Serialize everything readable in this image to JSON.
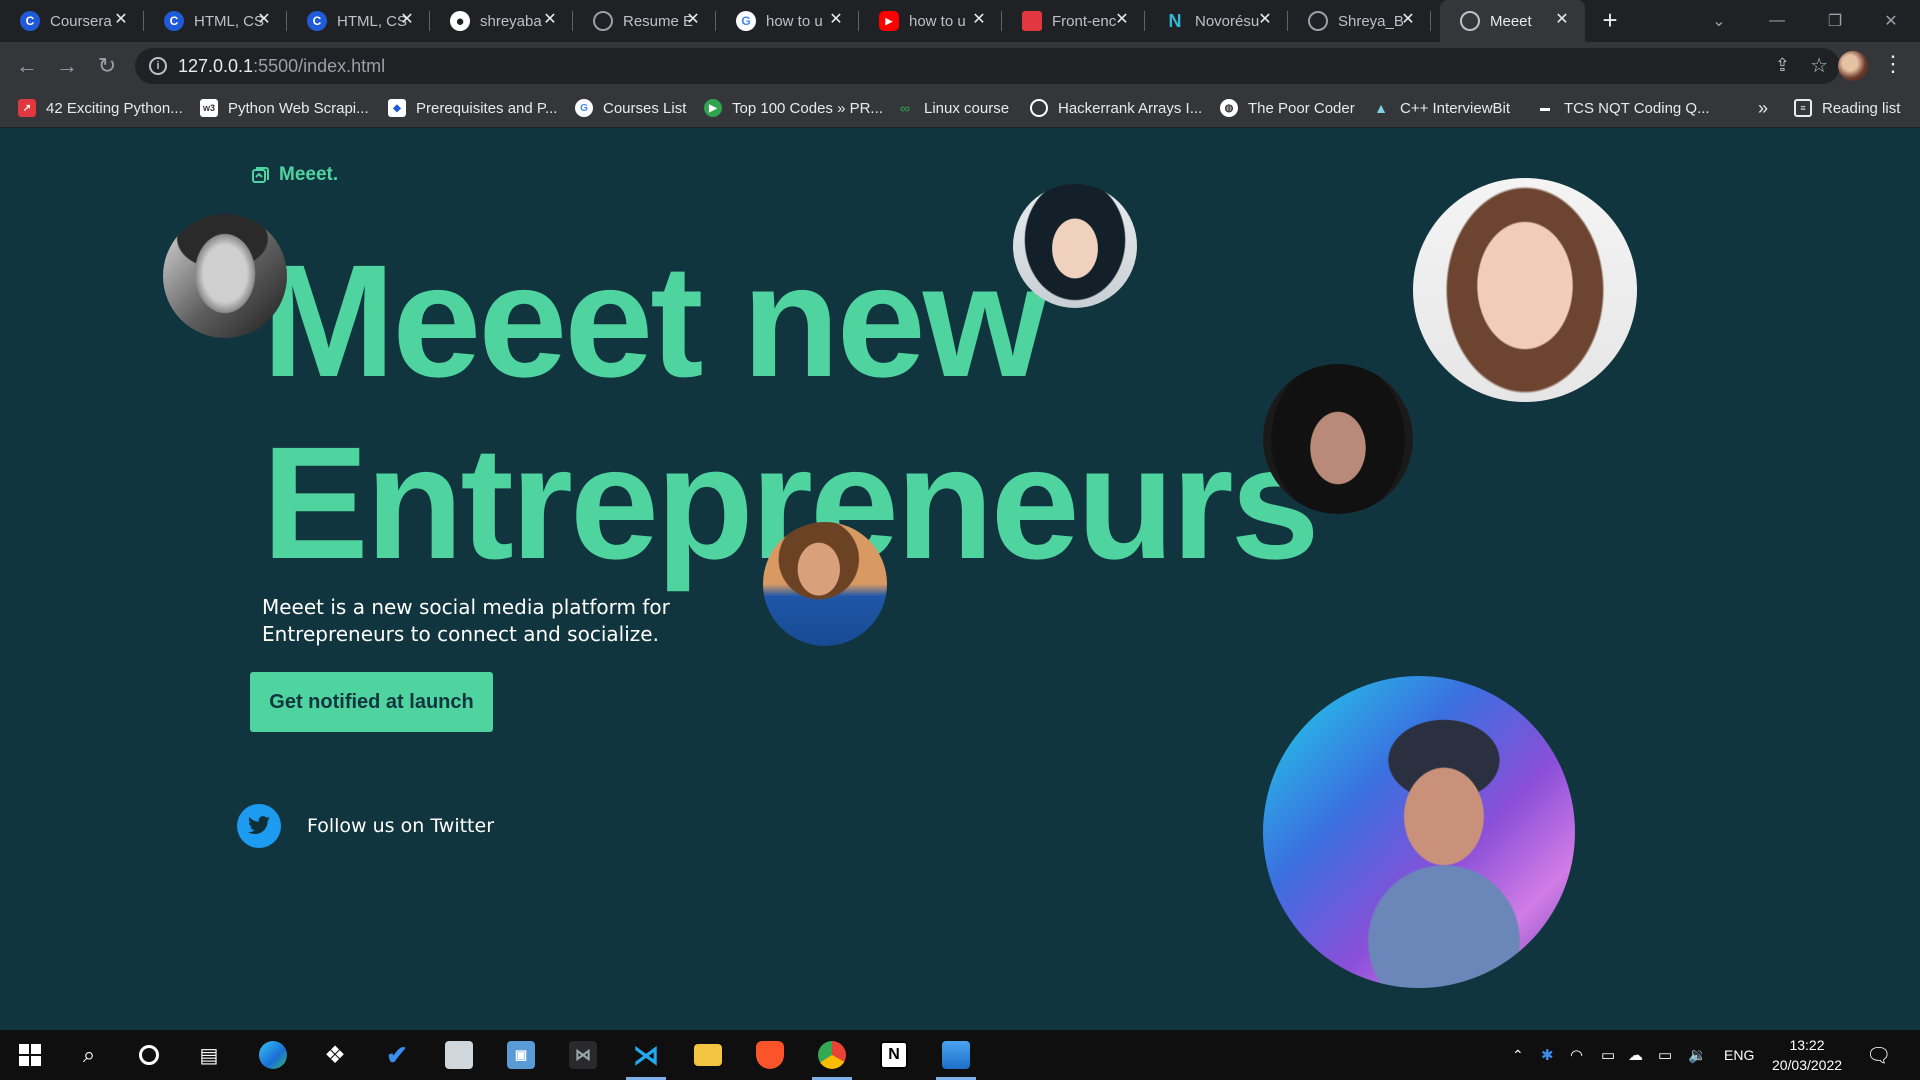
{
  "browser": {
    "tabs": [
      {
        "title": "Coursera",
        "icon": "coursera-icon",
        "color": "#1f5bd8",
        "glyph": "C",
        "active": false
      },
      {
        "title": "HTML, CS",
        "icon": "coursera-icon",
        "color": "#1f5bd8",
        "glyph": "C",
        "active": false
      },
      {
        "title": "HTML, CS",
        "icon": "coursera-icon",
        "color": "#1f5bd8",
        "glyph": "C",
        "active": false
      },
      {
        "title": "shreyaba",
        "icon": "github-icon",
        "color": "#ffffff",
        "glyph": "●",
        "active": false
      },
      {
        "title": "Resume E",
        "icon": "globe-icon",
        "color": "#9aa0a6",
        "glyph": "◍",
        "active": false
      },
      {
        "title": "how to u",
        "icon": "google-icon",
        "color": "#ffffff",
        "glyph": "G",
        "active": false
      },
      {
        "title": "how to u",
        "icon": "youtube-icon",
        "color": "#ff0000",
        "glyph": "▶",
        "active": false
      },
      {
        "title": "Front-enc",
        "icon": "frontend-mentor-icon",
        "color": "#e0383e",
        "glyph": "■",
        "active": false
      },
      {
        "title": "Novorésu",
        "icon": "novoresume-icon",
        "color": "#2fb9d8",
        "glyph": "N",
        "active": false
      },
      {
        "title": "Shreya_B",
        "icon": "globe-icon",
        "color": "#9aa0a6",
        "glyph": "◍",
        "active": false
      },
      {
        "title": "Meeet",
        "icon": "globe-icon",
        "color": "#9aa0a6",
        "glyph": "◍",
        "active": true
      }
    ],
    "url_host": "127.0.0.1",
    "url_rest": ":5500/index.html",
    "bookmarks": [
      {
        "label": "42 Exciting Python...",
        "color": "#e0383e",
        "glyph": "↗"
      },
      {
        "label": "Python Web Scrapi...",
        "color": "#ffffff",
        "glyph": "w3"
      },
      {
        "label": "Prerequisites and P...",
        "color": "#ffffff",
        "glyph": "◆"
      },
      {
        "label": "Courses List",
        "color": "#ffffff",
        "glyph": "G"
      },
      {
        "label": "Top 100 Codes » PR...",
        "color": "#2ea44f",
        "glyph": "▶"
      },
      {
        "label": "Linux course",
        "color": "#2f8d46",
        "glyph": "∞"
      },
      {
        "label": "Hackerrank Arrays I...",
        "color": "#ffffff",
        "glyph": "○"
      },
      {
        "label": "The Poor Coder",
        "color": "#ffffff",
        "glyph": "◍"
      },
      {
        "label": "C++ InterviewBit",
        "color": "#7fd1e6",
        "glyph": "▲"
      },
      {
        "label": "TCS NQT Coding Q...",
        "color": "#ffffff",
        "glyph": "▬"
      }
    ],
    "bookmarks_more": "»",
    "reading_list": "Reading list"
  },
  "page": {
    "logo": "Meeet.",
    "headline_line1": "Meeet new",
    "headline_line2": "Entrepreneurs",
    "subtitle": "Meeet is a new social media platform for Entrepreneurs to connect and socialize.",
    "cta": "Get notified at launch",
    "twitter_label": "Follow us on Twitter",
    "accent_color": "#4fd49f",
    "background_color": "#11353f"
  },
  "taskbar": {
    "apps": [
      "windows-start-icon",
      "search-icon",
      "cortana-icon",
      "task-view-icon",
      "edge-icon",
      "dropbox-icon",
      "todo-icon",
      "app-icon",
      "outlook-icon",
      "predator-icon",
      "vscode-icon",
      "file-explorer-icon",
      "brave-icon",
      "chrome-icon",
      "notion-icon",
      "photos-icon"
    ],
    "language": "ENG",
    "time": "13:22",
    "date": "20/03/2022"
  }
}
